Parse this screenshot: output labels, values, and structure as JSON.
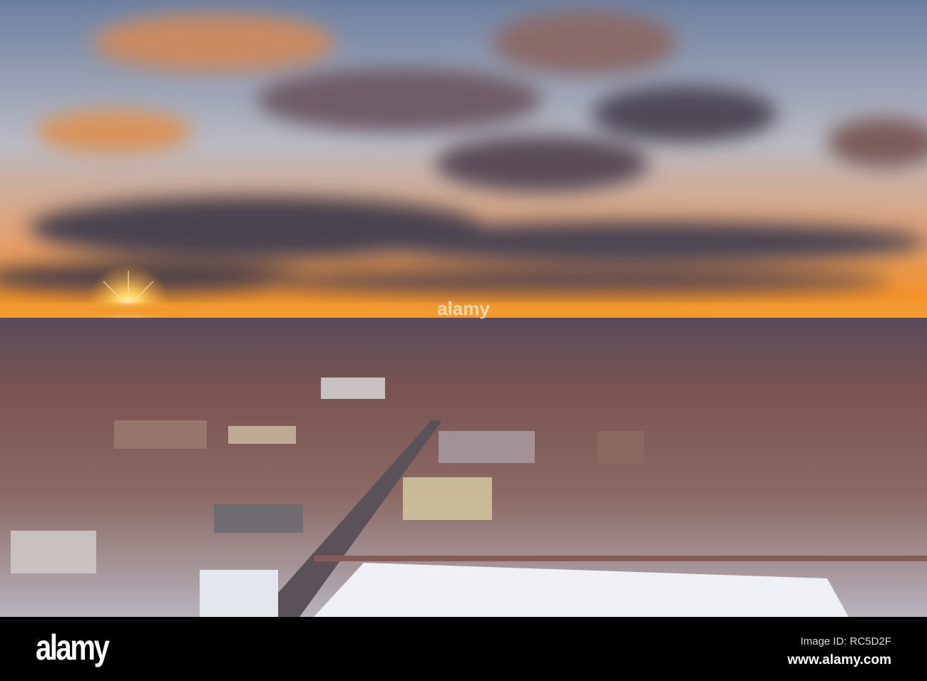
{
  "footer": {
    "logo": "alamy",
    "image_id": "Image ID: RC5D2F",
    "url": "www.alamy.com"
  },
  "watermark": "alamy",
  "colors": {
    "sky_top": "#6c7f9c",
    "horizon": "#f29a30",
    "sun": "#fff2b0",
    "cloud": "#4a4250",
    "town": "#6a4a48",
    "snow": "#e8eaf2"
  }
}
